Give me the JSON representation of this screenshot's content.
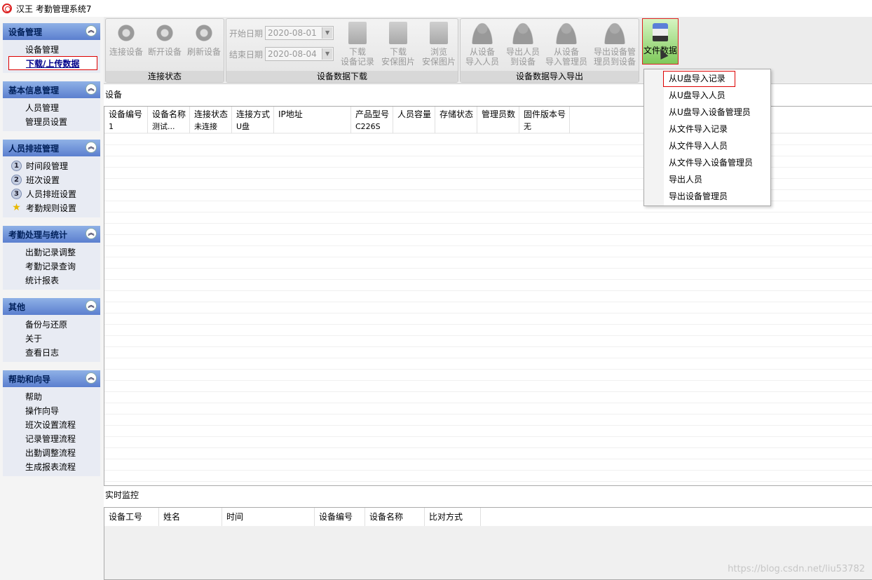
{
  "window": {
    "title": "汉王 考勤管理系统7"
  },
  "sidebar": {
    "groups": [
      {
        "title": "设备管理",
        "items": [
          "设备管理",
          "下载/上传数据"
        ]
      },
      {
        "title": "基本信息管理",
        "items": [
          "人员管理",
          "管理员设置"
        ]
      },
      {
        "title": "人员排班管理",
        "items": [
          "时间段管理",
          "班次设置",
          "人员排班设置",
          "考勤规则设置"
        ],
        "badges": [
          "1",
          "2",
          "3"
        ]
      },
      {
        "title": "考勤处理与统计",
        "items": [
          "出勤记录调整",
          "考勤记录查询",
          "统计报表"
        ]
      },
      {
        "title": "其他",
        "items": [
          "备份与还原",
          "关于",
          "查看日志"
        ]
      },
      {
        "title": "帮助和向导",
        "items": [
          "帮助",
          "操作向导",
          "班次设置流程",
          "记录管理流程",
          "出勤调整流程",
          "生成报表流程"
        ]
      }
    ]
  },
  "ribbon": {
    "conn": {
      "label": "连接状态",
      "buttons": [
        "连接设备",
        "断开设备",
        "刷新设备"
      ]
    },
    "download": {
      "label": "设备数据下载",
      "start_label": "开始日期",
      "start_value": "2020-08-01",
      "end_label": "结束日期",
      "end_value": "2020-08-04",
      "buttons": [
        [
          "下载",
          "设备记录"
        ],
        [
          "下载",
          "安保图片"
        ],
        [
          "浏览",
          "安保图片"
        ]
      ]
    },
    "io": {
      "label": "设备数据导入导出",
      "buttons": [
        [
          "从设备",
          "导入人员"
        ],
        [
          "导出人员",
          "到设备"
        ],
        [
          "从设备",
          "导入管理员"
        ],
        [
          "导出设备管",
          "理员到设备"
        ]
      ]
    },
    "file": {
      "label": "文件数据"
    }
  },
  "device": {
    "section_label": "设备",
    "columns": [
      "设备编号",
      "设备名称",
      "连接状态",
      "连接方式",
      "IP地址",
      "产品型号",
      "人员容量",
      "存储状态",
      "管理员数",
      "固件版本号"
    ],
    "rows": [
      [
        "1",
        "测试...",
        "未连接",
        "U盘",
        "",
        "C226S",
        "",
        "",
        "",
        "无"
      ]
    ]
  },
  "monitor": {
    "section_label": "实时监控",
    "columns": [
      "设备工号",
      "姓名",
      "时间",
      "设备编号",
      "设备名称",
      "比对方式"
    ]
  },
  "menu": {
    "items": [
      "从U盘导入记录",
      "从U盘导入人员",
      "从U盘导入设备管理员",
      "从文件导入记录",
      "从文件导入人员",
      "从文件导入设备管理员",
      "导出人员",
      "导出设备管理员"
    ]
  },
  "watermark": "https://blog.csdn.net/liu53782"
}
